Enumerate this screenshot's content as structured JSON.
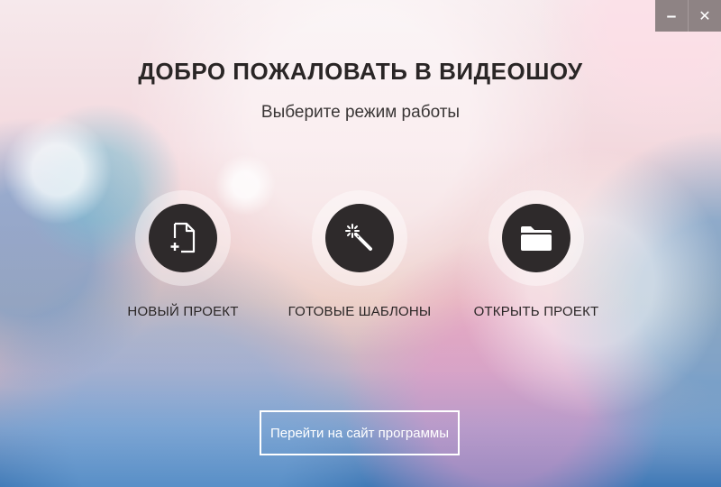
{
  "window": {
    "minimize_label": "‒",
    "close_label": "✕"
  },
  "header": {
    "title": "ДОБРО ПОЖАЛОВАТЬ В ВИДЕОШОУ",
    "subtitle": "Выберите режим работы"
  },
  "modes": [
    {
      "label": "НОВЫЙ ПРОЕКТ",
      "icon": "new-file-icon"
    },
    {
      "label": "ГОТОВЫЕ ШАБЛОНЫ",
      "icon": "magic-wand-icon"
    },
    {
      "label": "ОТКРЫТЬ ПРОЕКТ",
      "icon": "folder-icon"
    }
  ],
  "footer": {
    "site_button_label": "Перейти на сайт программы"
  },
  "colors": {
    "icon_disc": "#2e2a2b",
    "window_controls": "#8e8384",
    "text_dark": "#2a2626"
  }
}
